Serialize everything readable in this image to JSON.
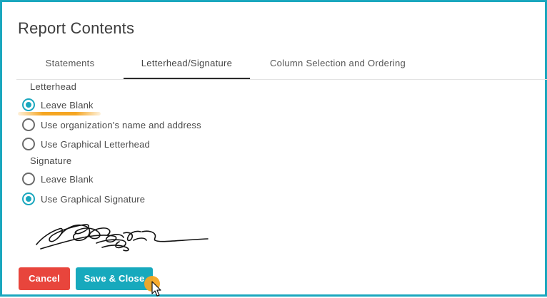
{
  "dialog": {
    "title": "Report Contents"
  },
  "tabs": [
    {
      "label": "Statements",
      "active": false
    },
    {
      "label": "Letterhead/Signature",
      "active": true
    },
    {
      "label": "Column Selection and Ordering",
      "active": false
    }
  ],
  "letterhead": {
    "label": "Letterhead",
    "options": [
      {
        "label": "Leave Blank",
        "checked": true
      },
      {
        "label": "Use organization's name and address",
        "checked": false
      },
      {
        "label": "Use Graphical Letterhead",
        "checked": false
      }
    ]
  },
  "signature": {
    "label": "Signature",
    "options": [
      {
        "label": "Leave Blank",
        "checked": false
      },
      {
        "label": "Use Graphical Signature",
        "checked": true
      }
    ]
  },
  "buttons": {
    "cancel_label": "Cancel",
    "save_label": "Save & Close"
  },
  "colors": {
    "accent": "#1aa7be",
    "cancel": "#e8453c",
    "highlight": "#f5a623"
  }
}
